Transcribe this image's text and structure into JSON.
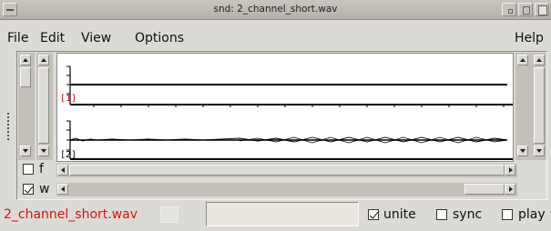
{
  "window": {
    "title": "snd: 2_channel_short.wav"
  },
  "menu": {
    "file": "File",
    "edit": "Edit",
    "view": "View",
    "options": "Options",
    "help": "Help"
  },
  "graph": {
    "channel_labels": [
      "[1]",
      "[2]"
    ],
    "channel_label_color": "#cc0000",
    "waveform_color": "#000000"
  },
  "controls": {
    "f_label": "f",
    "f_checked": false,
    "w_label": "w",
    "w_checked": true
  },
  "status": {
    "filename": "2_channel_short.wav",
    "filename_color": "#e01010",
    "minibuffer_value": "",
    "unite_label": "unite",
    "unite_checked": true,
    "sync_label": "sync",
    "sync_checked": false,
    "play_label": "play",
    "play_checked": false
  }
}
